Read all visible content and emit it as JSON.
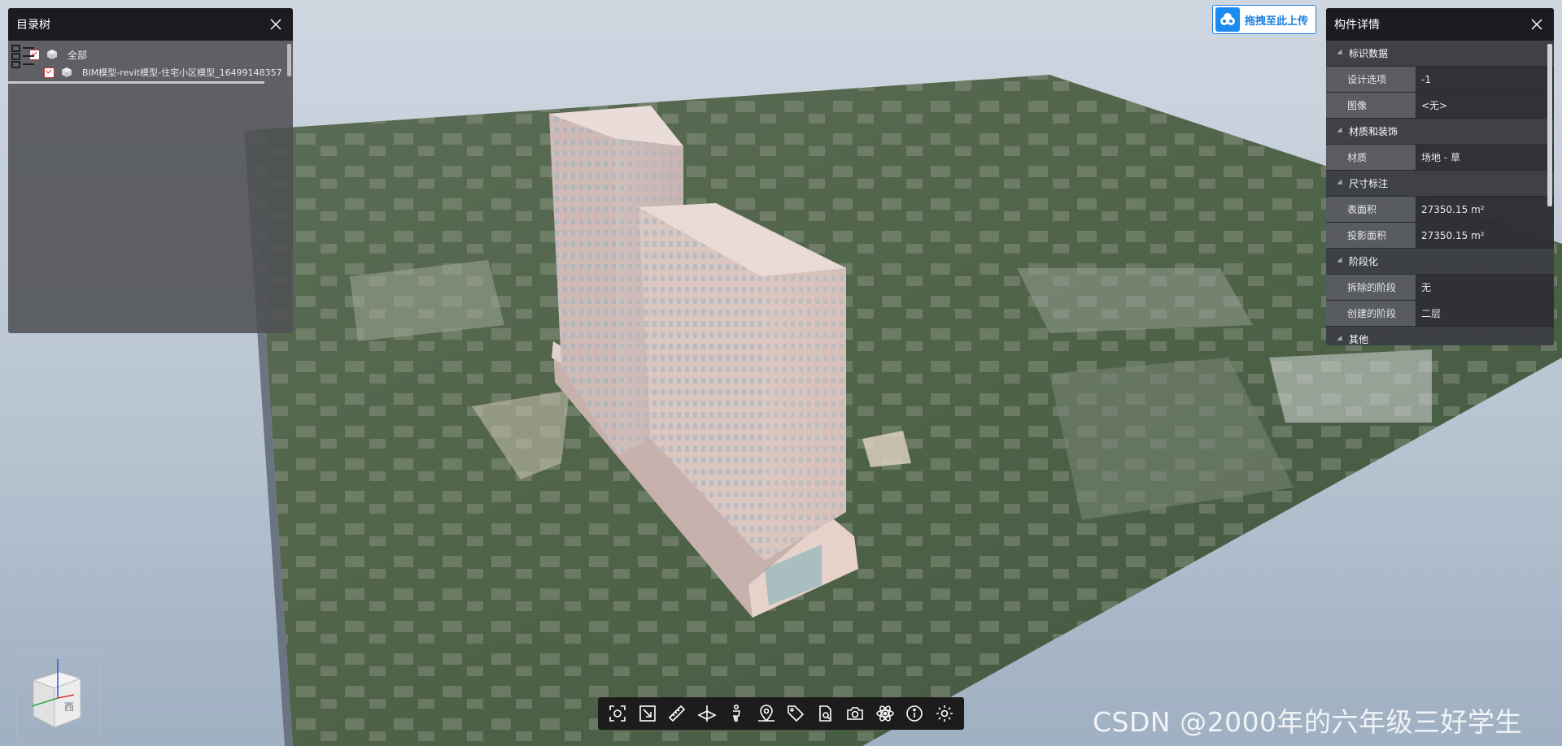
{
  "tree_panel": {
    "title": "目录树",
    "items": [
      {
        "label": "全部",
        "checked": true
      },
      {
        "label": "BIM模型-revit模型-住宅小区模型_16499148357",
        "checked": true
      }
    ]
  },
  "upload": {
    "label": "拖拽至此上传",
    "icon": "cloud-upload-icon",
    "color": "#1a8cf0"
  },
  "props_panel": {
    "title": "构件详情",
    "sections": [
      {
        "title": "标识数据",
        "rows": [
          {
            "key": "设计选项",
            "value": "-1"
          },
          {
            "key": "图像",
            "value": "<无>"
          }
        ]
      },
      {
        "title": "材质和装饰",
        "rows": [
          {
            "key": "材质",
            "value": "场地 - 草"
          }
        ]
      },
      {
        "title": "尺寸标注",
        "rows": [
          {
            "key": "表面积",
            "value": "27350.15 m²"
          },
          {
            "key": "投影面积",
            "value": "27350.15 m²"
          }
        ]
      },
      {
        "title": "阶段化",
        "rows": [
          {
            "key": "拆除的阶段",
            "value": "无"
          },
          {
            "key": "创建的阶段",
            "value": "二层"
          }
        ]
      },
      {
        "title": "其他",
        "rows": []
      }
    ]
  },
  "navcube": {
    "face_label": "西"
  },
  "toolbar": [
    {
      "name": "fit-view-icon"
    },
    {
      "name": "box-select-icon"
    },
    {
      "name": "measure-ruler-icon"
    },
    {
      "name": "section-plane-icon"
    },
    {
      "name": "walk-person-icon"
    },
    {
      "name": "map-pin-icon"
    },
    {
      "name": "tag-icon"
    },
    {
      "name": "document-search-icon"
    },
    {
      "name": "camera-icon"
    },
    {
      "name": "explode-atom-icon"
    },
    {
      "name": "info-icon"
    },
    {
      "name": "settings-gear-icon"
    }
  ],
  "watermark": "CSDN @2000年的六年级三好学生"
}
